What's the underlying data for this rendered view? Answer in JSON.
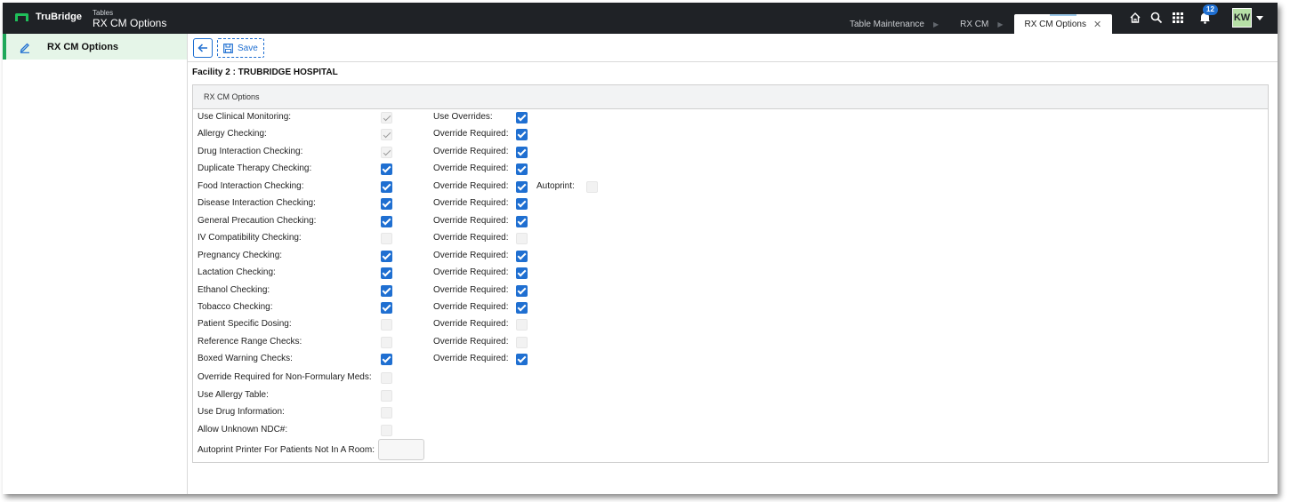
{
  "app": {
    "brand": "TruBridge",
    "section_label": "Tables",
    "page_title": "RX CM Options"
  },
  "tabs": [
    {
      "label": "Table Maintenance",
      "active": false
    },
    {
      "label": "RX CM",
      "active": false
    },
    {
      "label": "RX CM Options",
      "active": true
    }
  ],
  "header_tools": {
    "notification_count": "12",
    "user_initials": "KW"
  },
  "sidebar": {
    "items": [
      {
        "label": "RX CM Options",
        "icon": "pencil-icon"
      }
    ]
  },
  "toolbar": {
    "save_label": "Save",
    "back_icon": "arrow-left-icon",
    "save_icon": "save-icon"
  },
  "facility": {
    "label": "Facility 2 : TRUBRIDGE HOSPITAL"
  },
  "panel": {
    "title": "RX CM Options",
    "rows": [
      {
        "label": "Use Clinical Monitoring:",
        "state": "disabled-checked",
        "override_label": "Use Overrides:",
        "override_state": "checked"
      },
      {
        "label": "Allergy Checking:",
        "state": "disabled-checked",
        "override_label": "Override Required:",
        "override_state": "checked"
      },
      {
        "label": "Drug Interaction Checking:",
        "state": "disabled-checked",
        "override_label": "Override Required:",
        "override_state": "checked"
      },
      {
        "label": "Duplicate Therapy Checking:",
        "state": "checked",
        "override_label": "Override Required:",
        "override_state": "checked"
      },
      {
        "label": "Food Interaction Checking:",
        "state": "checked",
        "override_label": "Override Required:",
        "override_state": "checked",
        "extra_label": "Autoprint:",
        "extra_state": "disabled"
      },
      {
        "label": "Disease Interaction Checking:",
        "state": "checked",
        "override_label": "Override Required:",
        "override_state": "checked"
      },
      {
        "label": "General Precaution Checking:",
        "state": "checked",
        "override_label": "Override Required:",
        "override_state": "checked"
      },
      {
        "label": "IV Compatibility Checking:",
        "state": "disabled",
        "override_label": "Override Required:",
        "override_state": "disabled"
      },
      {
        "label": "Pregnancy Checking:",
        "state": "checked",
        "override_label": "Override Required:",
        "override_state": "checked"
      },
      {
        "label": "Lactation Checking:",
        "state": "checked",
        "override_label": "Override Required:",
        "override_state": "checked"
      },
      {
        "label": "Ethanol Checking:",
        "state": "checked",
        "override_label": "Override Required:",
        "override_state": "checked"
      },
      {
        "label": "Tobacco Checking:",
        "state": "checked",
        "override_label": "Override Required:",
        "override_state": "checked"
      },
      {
        "label": "Patient Specific Dosing:",
        "state": "disabled",
        "override_label": "Override Required:",
        "override_state": "disabled"
      },
      {
        "label": "Reference Range Checks:",
        "state": "disabled",
        "override_label": "Override Required:",
        "override_state": "disabled"
      },
      {
        "label": "Boxed Warning Checks:",
        "state": "checked",
        "override_label": "Override Required:",
        "override_state": "checked"
      }
    ],
    "extra_rows": [
      {
        "label": "Override Required for Non-Formulary Meds:",
        "state": "disabled"
      },
      {
        "label": "Use Allergy Table:",
        "state": "disabled"
      },
      {
        "label": "Use Drug Information:",
        "state": "disabled"
      },
      {
        "label": "Allow Unknown NDC#:",
        "state": "disabled"
      }
    ],
    "printer_label": "Autoprint Printer For Patients Not In A Room:",
    "printer_value": ""
  }
}
